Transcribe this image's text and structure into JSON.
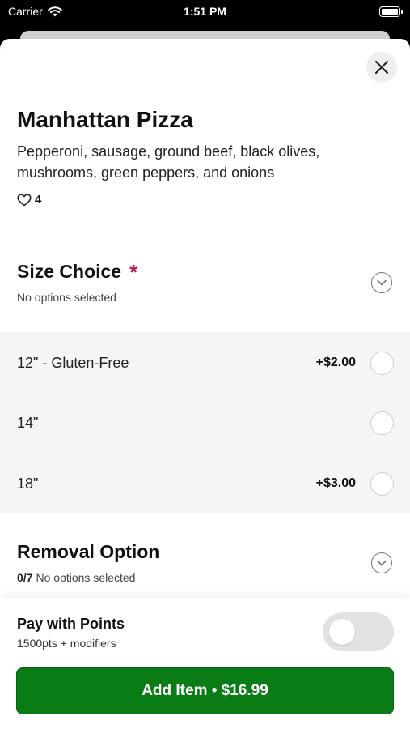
{
  "status_bar": {
    "carrier": "Carrier",
    "time": "1:51 PM"
  },
  "item": {
    "title": "Manhattan Pizza",
    "description": "Pepperoni, sausage, ground beef, black olives, mushrooms, green peppers, and onions",
    "likes": "4"
  },
  "size_choice": {
    "title": "Size Choice",
    "required_mark": "*",
    "status": "No options selected",
    "options": [
      {
        "label": "12\" - Gluten-Free",
        "price": "+$2.00"
      },
      {
        "label": "14\"",
        "price": ""
      },
      {
        "label": "18\"",
        "price": "+$3.00"
      }
    ]
  },
  "removal_option": {
    "title": "Removal Option",
    "count": "0/7",
    "status": "No options selected"
  },
  "points": {
    "title": "Pay with Points",
    "subtitle": "1500pts + modifiers",
    "enabled": false
  },
  "add_button": {
    "label": "Add Item • $16.99"
  },
  "colors": {
    "accent_green": "#0a7c16",
    "required_red": "#c0144b"
  }
}
